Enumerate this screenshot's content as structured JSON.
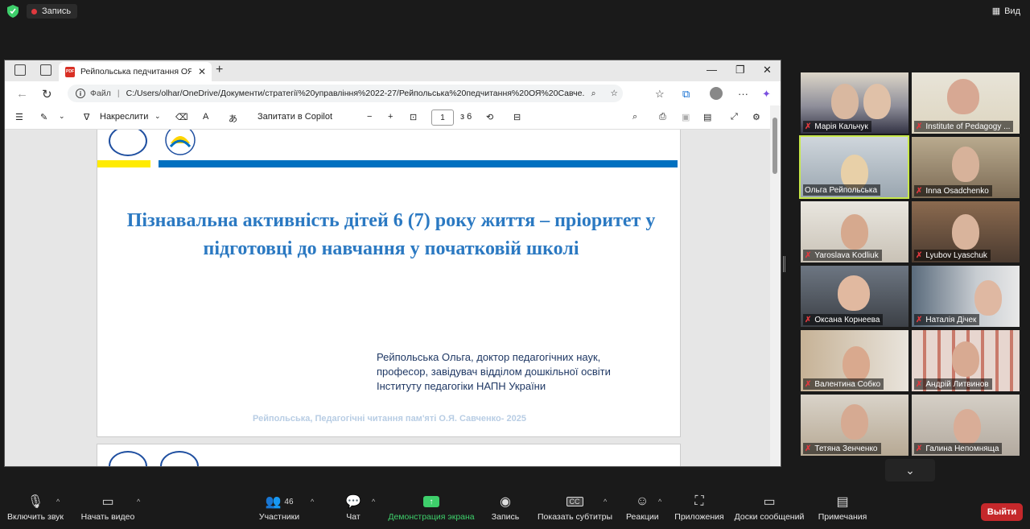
{
  "meeting": {
    "recording_label": "Запись",
    "view_label": "Вид"
  },
  "browser": {
    "tab_title": "Рейпольська педчитання ОЯ Са",
    "address_label": "Файл",
    "url": "C:/Users/olhar/OneDrive/Документи/стратегії%20управління%2022-27/Рейпольська%20педчитання%20ОЯ%20Савче..."
  },
  "pdf_toolbar": {
    "draw_label": "Накреслити",
    "copilot_label": "Запитати в Copilot",
    "current_page": "1",
    "page_total": "з 6"
  },
  "slide": {
    "title": "Пізнавальна активність дітей 6 (7) року життя – пріоритет у підготовці до навчання у початковій школі",
    "author_line1": "Рейпольська Ольга, доктор педагогічних наук,",
    "author_line2": "професор, завідувач відділом дошкільної освіти",
    "author_line3": "Інституту педагогіки НАПН України",
    "footer": "Рейпольська, Педагогічні читання пам'яті О.Я. Савченко- 2025"
  },
  "participants": [
    {
      "name": "Марія Кальчук"
    },
    {
      "name": "Institute of Pedagogy ..."
    },
    {
      "name": "Ольга Рейпольська",
      "active": true
    },
    {
      "name": "Inna Osadchenko"
    },
    {
      "name": "Yaroslava Kodliuk"
    },
    {
      "name": "Lyubov Lyaschuk"
    },
    {
      "name": "Оксана Корнеева"
    },
    {
      "name": "Наталія Дічек"
    },
    {
      "name": "Валентина Собко"
    },
    {
      "name": "Андрій Литвинов"
    },
    {
      "name": "Тетяна Зенченко"
    },
    {
      "name": "Галина Непомняща"
    }
  ],
  "toolbar": {
    "audio": "Включить звук",
    "video": "Начать видео",
    "participants": "Участники",
    "participants_count": "46",
    "chat": "Чат",
    "share": "Демонстрация экрана",
    "record": "Запись",
    "captions": "Показать субтитры",
    "reactions": "Реакции",
    "apps": "Приложения",
    "whiteboards": "Доски сообщений",
    "notes": "Примечания",
    "leave": "Выйти"
  },
  "colors": {
    "accent_green": "#3ecf6b",
    "leave_red": "#c5282b",
    "slide_title_blue": "#2b79c2",
    "active_border": "#c8e84a"
  }
}
